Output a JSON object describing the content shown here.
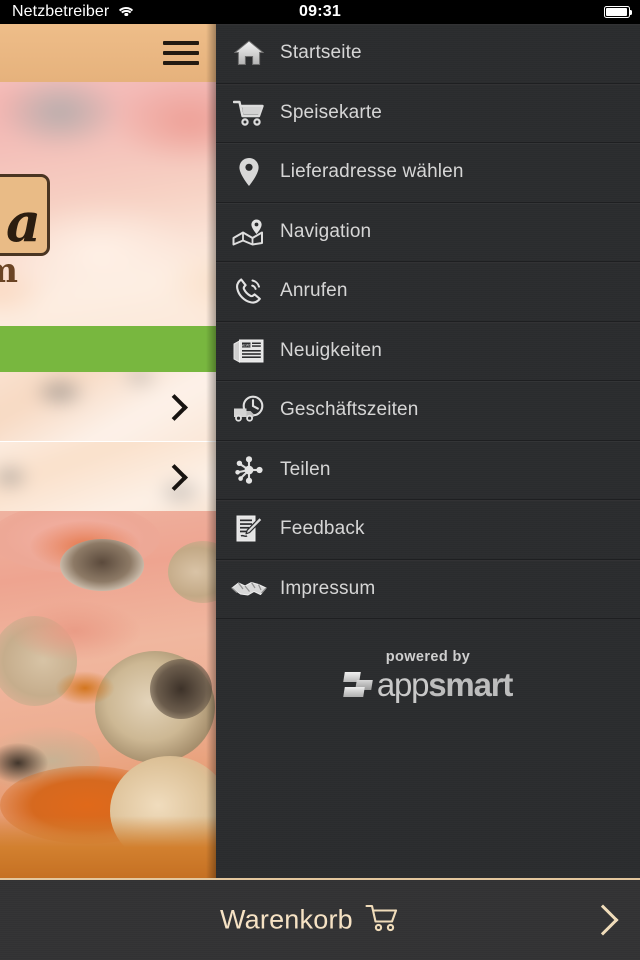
{
  "status_bar": {
    "carrier": "Netzbetreiber",
    "wifi_icon": "wifi-icon",
    "time": "09:31",
    "battery_icon": "battery-full-icon"
  },
  "background_app": {
    "header": {
      "menu_button_icon": "hamburger-icon",
      "background_color": "#e8b681"
    },
    "hero": {
      "logo_badge_text": "a",
      "logo_subtitle_text": "m"
    },
    "green_banner_color": "#78b73f",
    "list_rows": [
      {
        "chevron_icon": "chevron-right-icon"
      },
      {
        "chevron_icon": "chevron-right-icon"
      }
    ]
  },
  "drawer": {
    "background_color": "#2b2c2e",
    "items": [
      {
        "label": "Startseite",
        "icon": "home-icon"
      },
      {
        "label": "Speisekarte",
        "icon": "shopping-cart-icon"
      },
      {
        "label": "Lieferadresse wählen",
        "icon": "map-pin-icon"
      },
      {
        "label": "Navigation",
        "icon": "map-navigation-icon"
      },
      {
        "label": "Anrufen",
        "icon": "phone-icon"
      },
      {
        "label": "Neuigkeiten",
        "icon": "newspaper-icon"
      },
      {
        "label": "Geschäftszeiten",
        "icon": "delivery-truck-clock-icon"
      },
      {
        "label": "Teilen",
        "icon": "share-nodes-icon"
      },
      {
        "label": "Feedback",
        "icon": "form-pencil-icon"
      },
      {
        "label": "Impressum",
        "icon": "handshake-icon"
      }
    ],
    "footer": {
      "powered_by_text": "powered by",
      "brand_first": "app",
      "brand_second": "smart",
      "brand_mark_icon": "appsmart-logo-icon"
    }
  },
  "cart_bar": {
    "label": "Warenkorb",
    "cart_icon": "shopping-cart-icon",
    "chevron_icon": "chevron-right-icon",
    "accent_color": "#f6e2c4"
  }
}
